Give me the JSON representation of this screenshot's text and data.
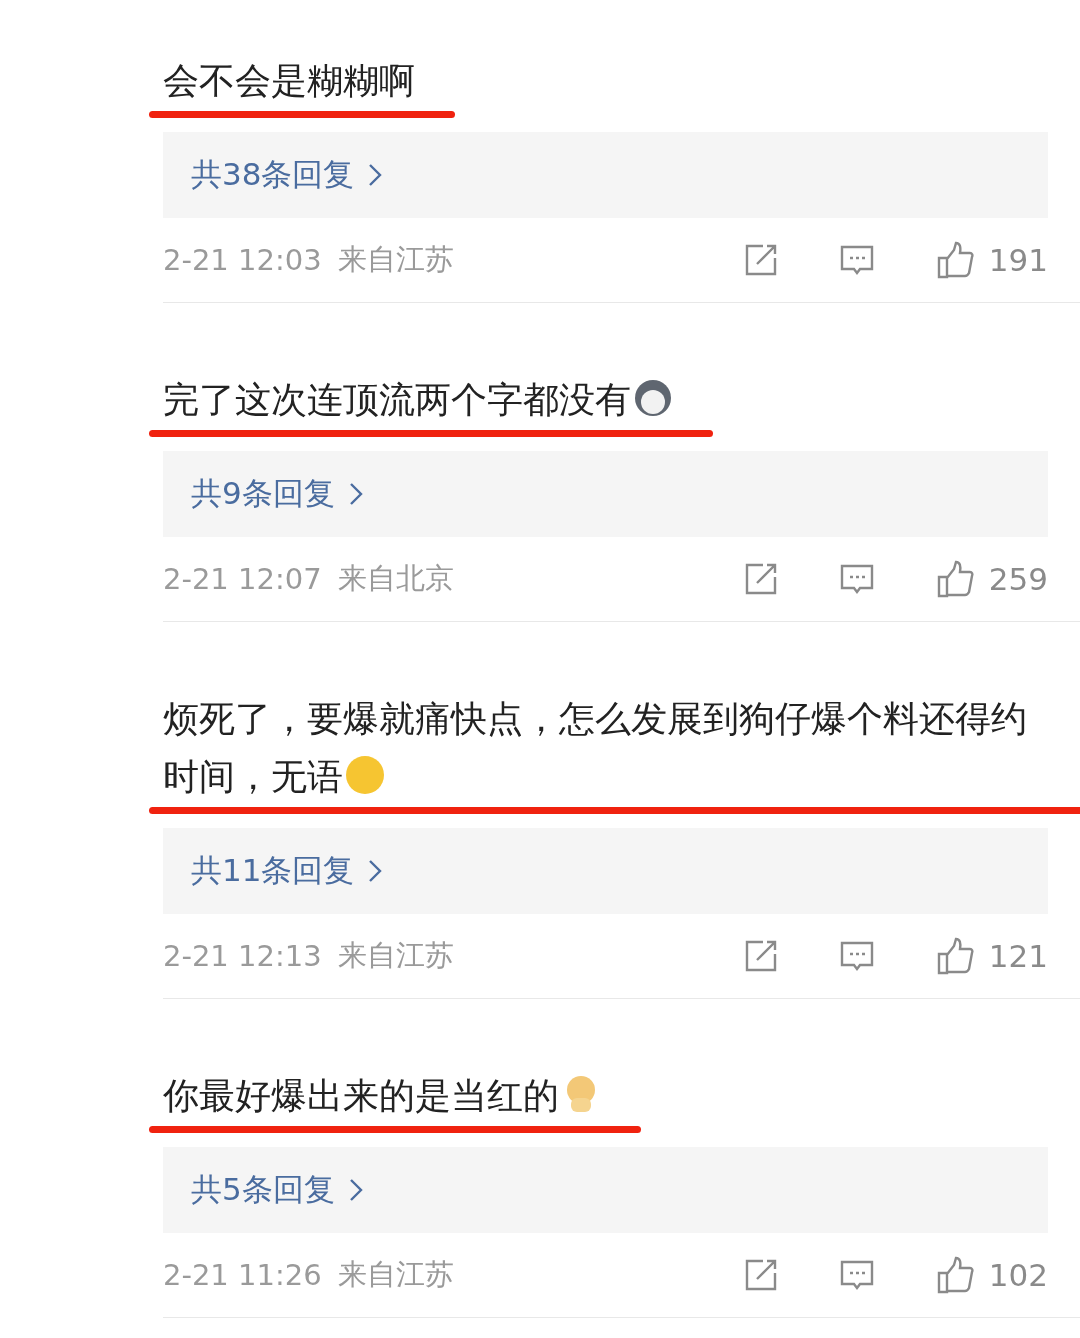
{
  "comments": [
    {
      "text": "会不会是糊糊啊",
      "underlined": true,
      "replies": "共38条回复",
      "time": "2-21 12:03",
      "location": "来自江苏",
      "likes": "191"
    },
    {
      "text": "完了这次连顶流两个字都没有",
      "sticker": {
        "kind": "husky"
      },
      "underlined": true,
      "replies": "共9条回复",
      "time": "2-21 12:07",
      "location": "来自北京",
      "likes": "259"
    },
    {
      "text": "烦死了，要爆就痛快点，怎么发展到狗仔爆个料还得约时间，无语",
      "sticker": {
        "kind": "neutral"
      },
      "underlined": true,
      "replies": "共11条回复",
      "time": "2-21 12:13",
      "location": "来自江苏",
      "likes": "121"
    },
    {
      "text": "你最好爆出来的是当红的",
      "sticker": {
        "kind": "doge"
      },
      "underlined": true,
      "replies": "共5条回复",
      "time": "2-21 11:26",
      "location": "来自江苏",
      "likes": "102"
    }
  ]
}
